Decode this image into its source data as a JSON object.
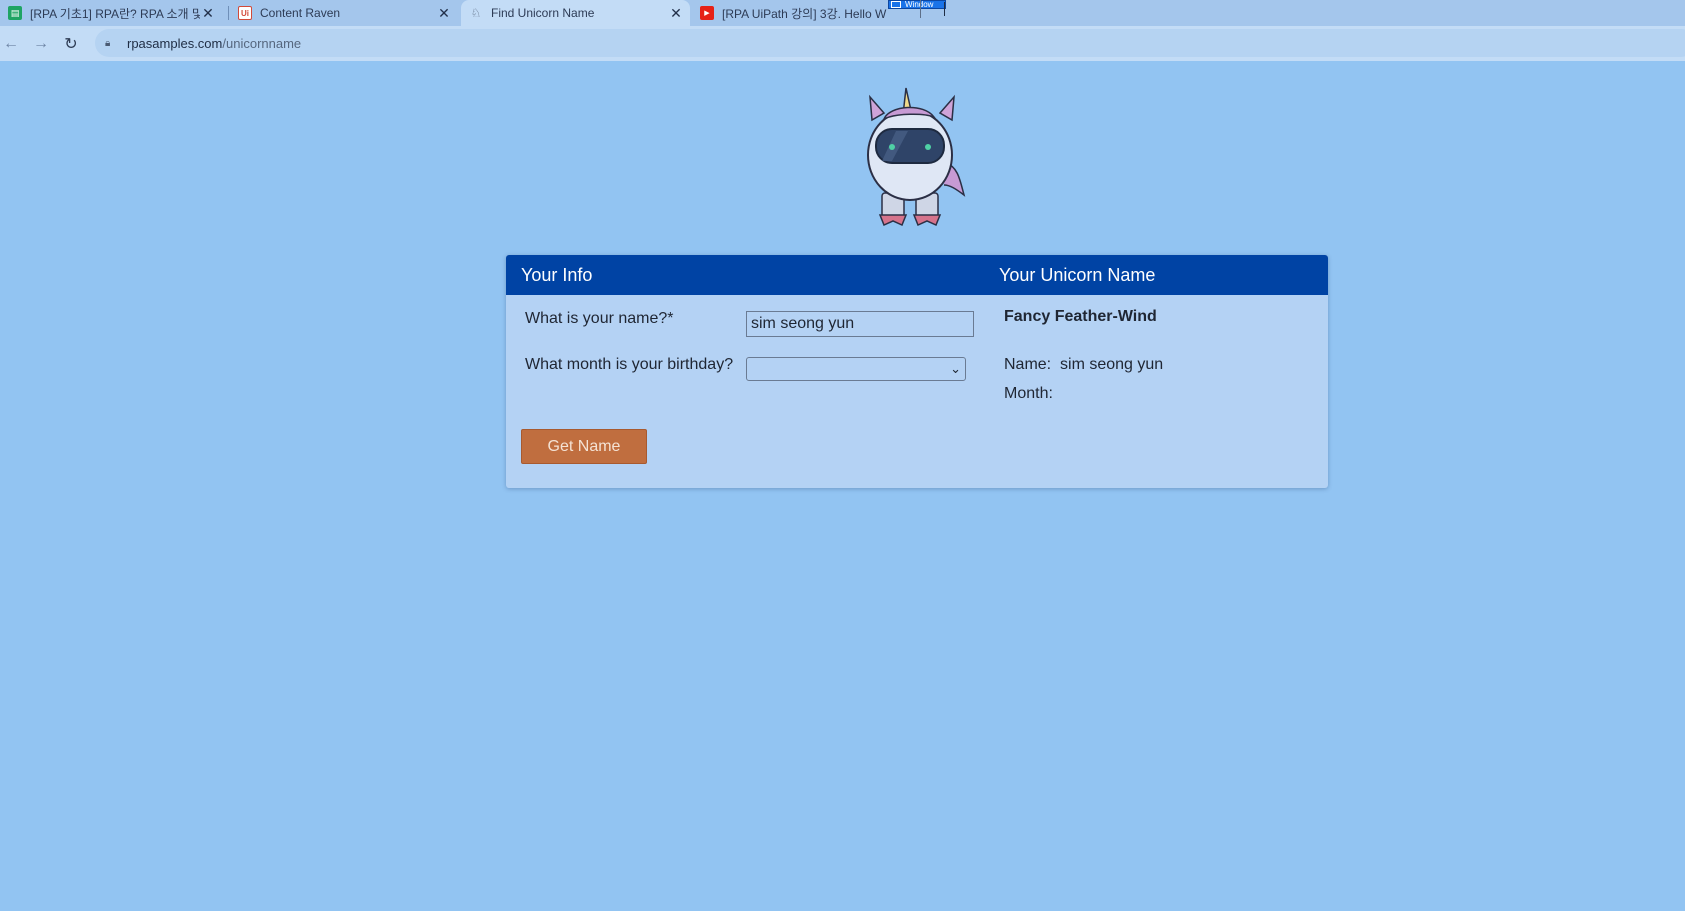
{
  "browser": {
    "tabs": [
      {
        "title": "[RPA 기초1] RPA란? RPA 소개 및",
        "favicon": "sheets-icon",
        "active": false
      },
      {
        "title": "Content Raven",
        "favicon": "uipath-icon",
        "active": false
      },
      {
        "title": "Find Unicorn Name",
        "favicon": "unicorn-favicon",
        "active": true
      },
      {
        "title": "[RPA UiPath 강의] 3강. Hello W",
        "favicon": "youtube-icon",
        "active": false
      }
    ],
    "floating_window_label": "Window",
    "url_host": "rpasamples.com",
    "url_path": "/unicornname"
  },
  "form": {
    "header_left": "Your Info",
    "header_right": "Your Unicorn Name",
    "name_label": "What is your name?*",
    "name_value": "sim seong yun",
    "month_label": "What month is your birthday?",
    "month_value": "",
    "button_label": "Get Name"
  },
  "result": {
    "unicorn_name": "Fancy Feather-Wind",
    "name_label": "Name:",
    "name_value": "sim seong yun",
    "month_label": "Month:",
    "month_value": ""
  },
  "colors": {
    "page_bg": "#92c4f2",
    "header_bg": "#0043a4",
    "card_bg": "#b4d2f4",
    "button_bg": "#c06e3f"
  }
}
